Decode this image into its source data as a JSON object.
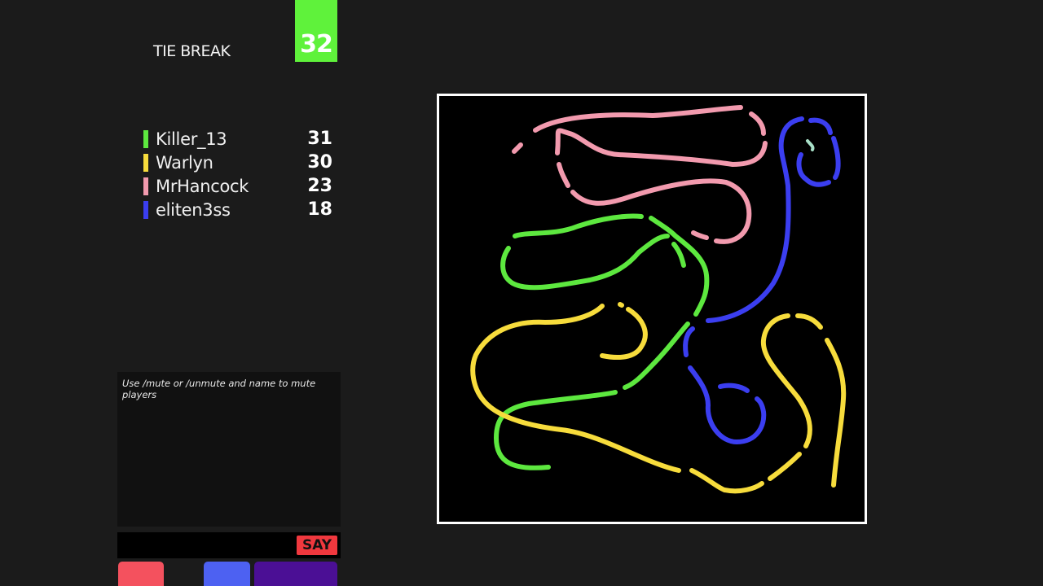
{
  "header": {
    "round_label": "TIE BREAK",
    "target_score": "32",
    "target_color": "#5ff23b"
  },
  "scoreboard": [
    {
      "name": "Killer_13",
      "score": "31",
      "color": "#5de83f"
    },
    {
      "name": "Warlyn",
      "score": "30",
      "color": "#f7dc3c"
    },
    {
      "name": "MrHancock",
      "score": "23",
      "color": "#f29aae"
    },
    {
      "name": "eliten3ss",
      "score": "18",
      "color": "#3b3ef0"
    }
  ],
  "chat": {
    "messages": [
      "Use /mute or /unmute and name to mute players"
    ],
    "input_value": "",
    "say_label": "SAY",
    "say_color": "#f0383e"
  },
  "bottom_buttons": [
    {
      "color": "#f4515e"
    },
    {
      "color": "#4d61f2"
    },
    {
      "color": "#4b0f95"
    }
  ]
}
